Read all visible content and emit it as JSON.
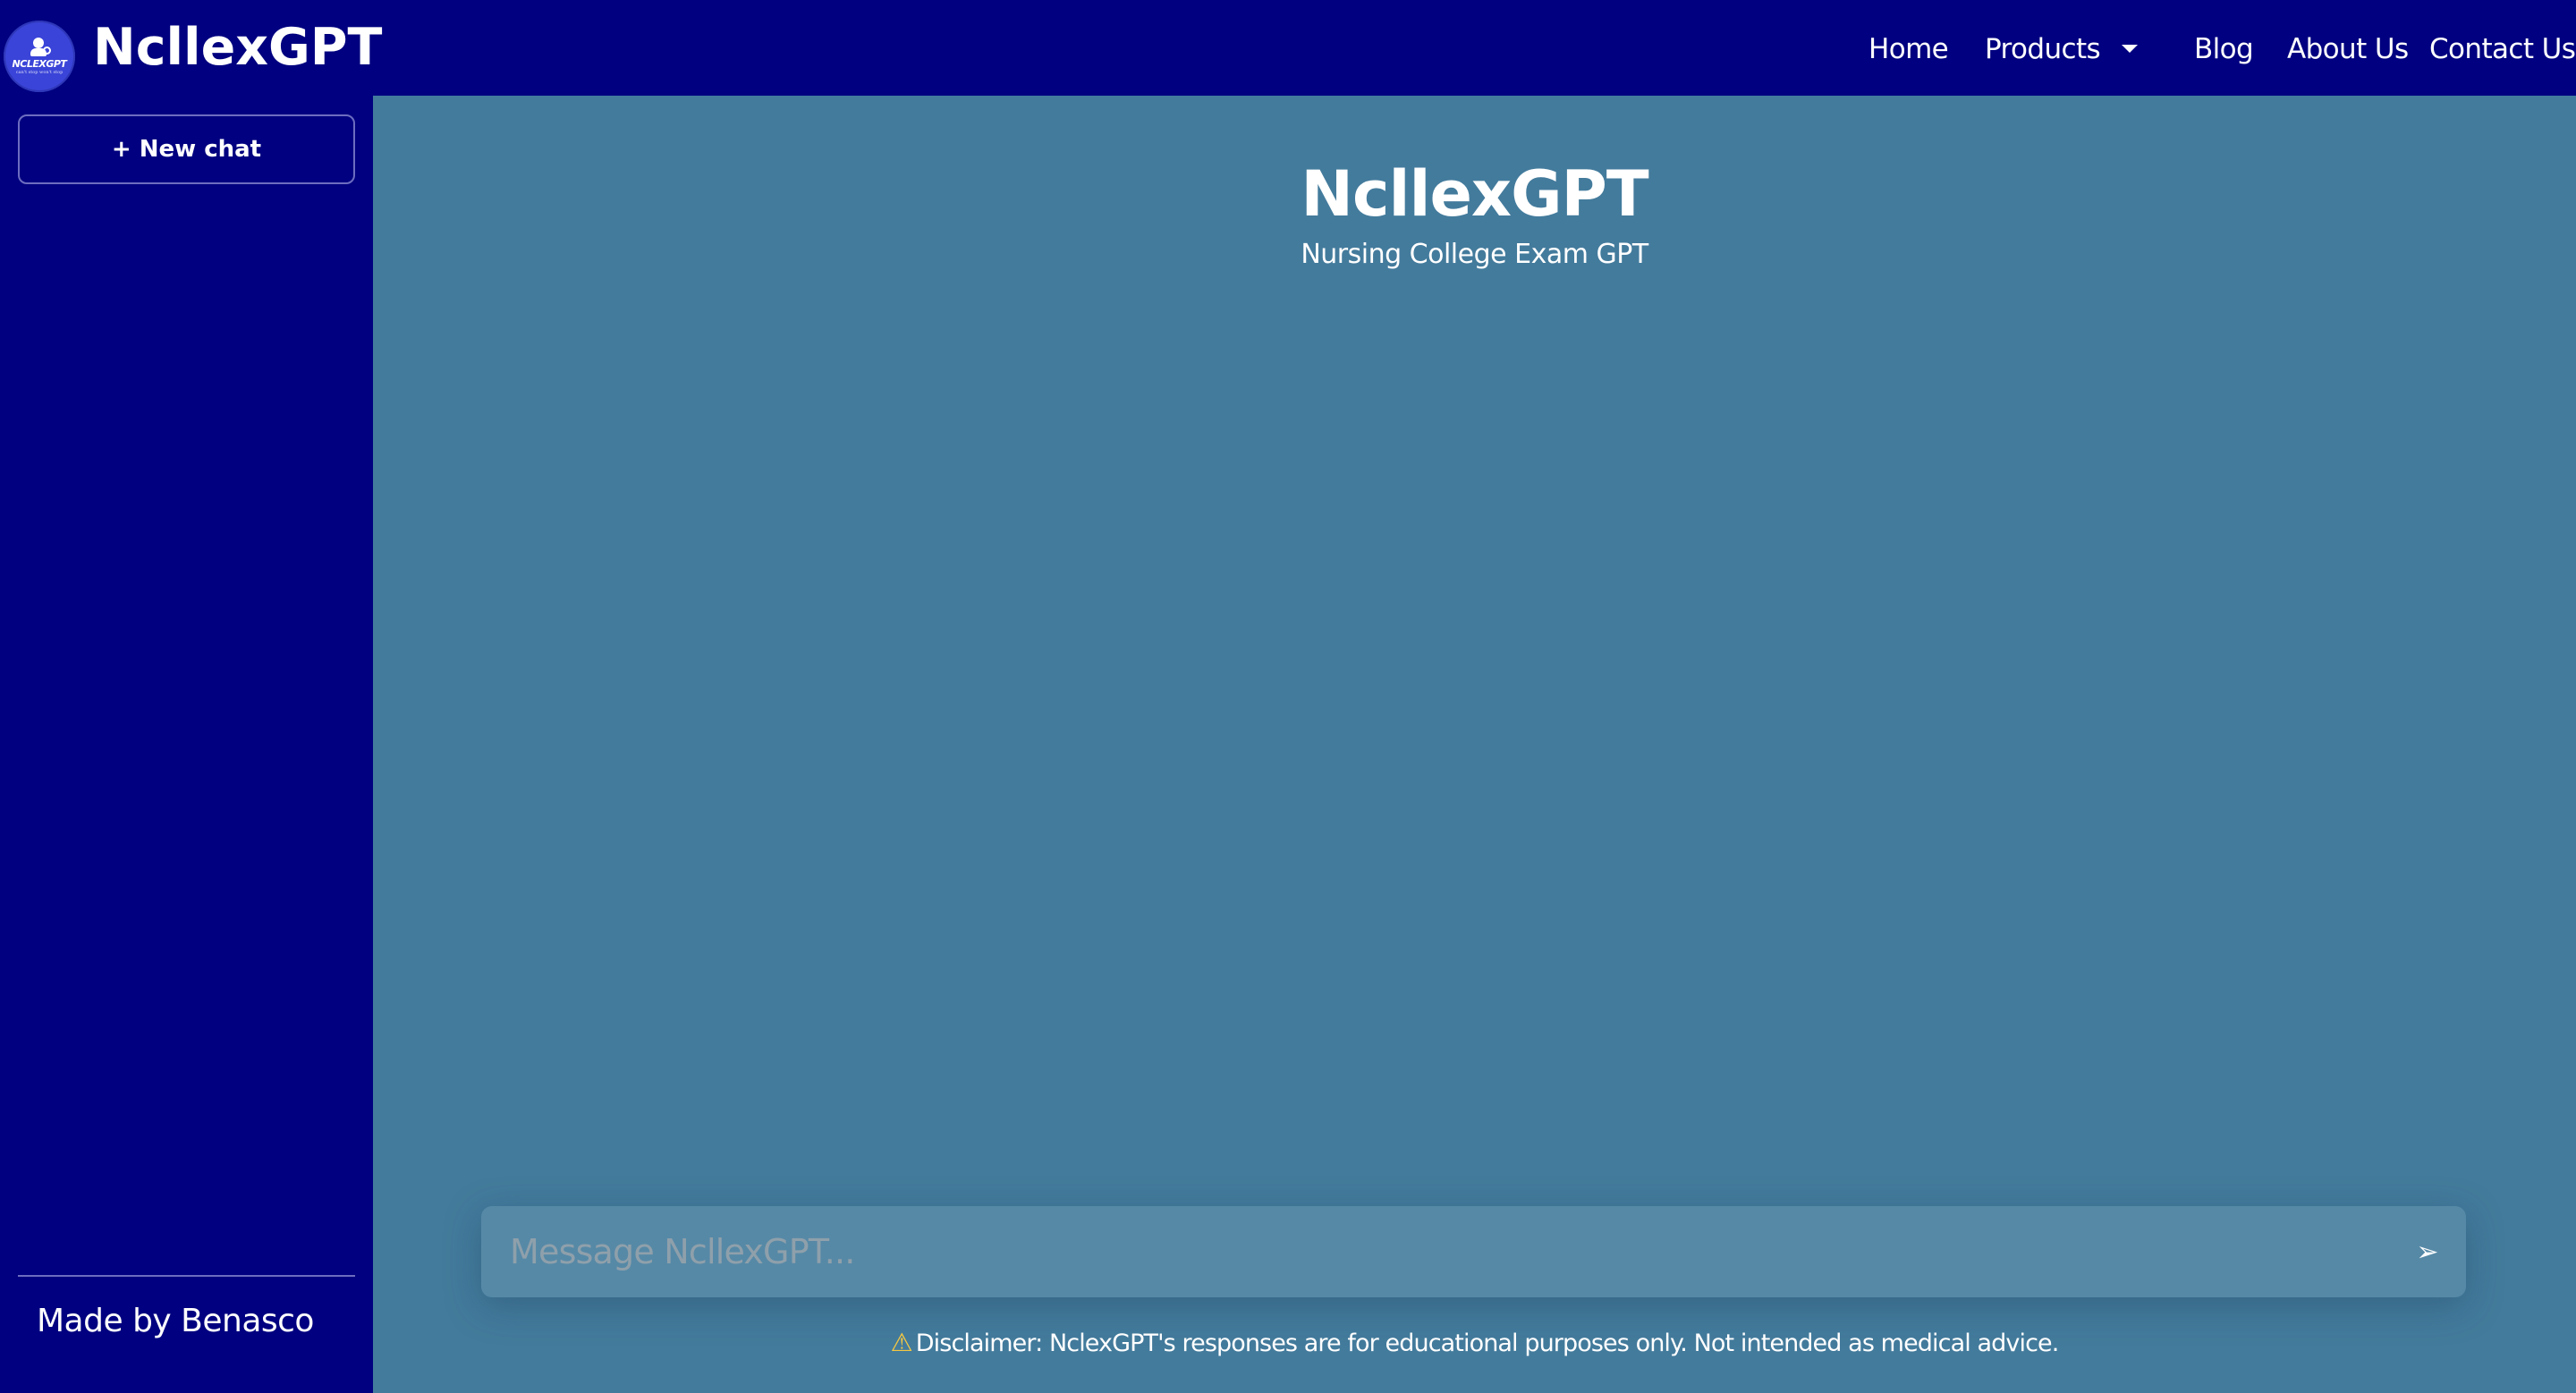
{
  "header": {
    "logo": {
      "wordmark": "NCLEXGPT",
      "tagline": "can't stop won't stop",
      "icon": "nurse-gear-logo"
    },
    "brand": "NcllexGPT",
    "nav": [
      {
        "label": "Home"
      },
      {
        "label": "Products",
        "icon": "caret-down-icon"
      },
      {
        "label": "Blog"
      },
      {
        "label": "About Us"
      },
      {
        "label": "Contact Us"
      }
    ]
  },
  "sidebar": {
    "new_chat_label": "+ New chat",
    "footer": "Made by Benasco"
  },
  "main": {
    "title": "NcllexGPT",
    "subtitle": "Nursing College Exam GPT",
    "input": {
      "placeholder": "Message NcllexGPT...",
      "value": ""
    },
    "send_icon": "➢",
    "disclaimer_icon": "⚠",
    "disclaimer": "Disclaimer: NclexGPT's responses are for educational purposes only. Not intended as medical advice."
  },
  "colors": {
    "header_bg": "#000080",
    "sidebar_bg": "#000080",
    "main_bg": "#437b9c",
    "input_bg": "#5689a6",
    "logo_bg": "#3a44d8",
    "warning": "#f5c842"
  }
}
